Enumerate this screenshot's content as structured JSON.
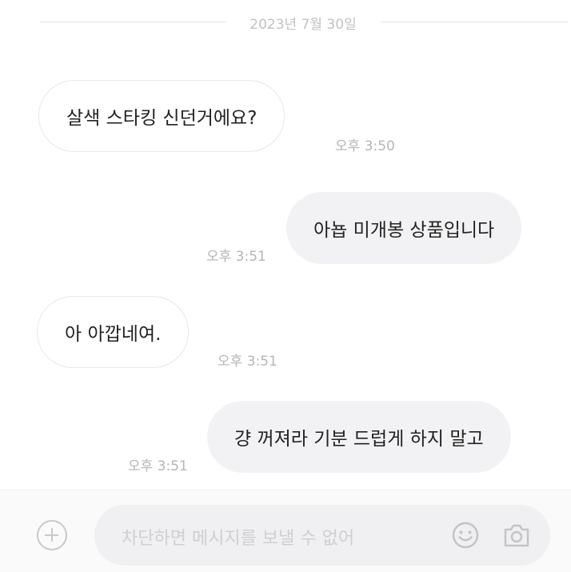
{
  "chat": {
    "date": "2023년 7월 30일",
    "messages": [
      {
        "side": "received",
        "text": "살색 스타킹 신던거에요?",
        "time": "오후 3:50"
      },
      {
        "side": "sent",
        "text": "아뇹 미개봉 상품입니다",
        "time": "오후 3:51"
      },
      {
        "side": "received",
        "text": "아 아깝네여.",
        "time": "오후 3:51"
      },
      {
        "side": "sent",
        "text": "걍 꺼져라 기분 드럽게 하지 말고",
        "time": "오후 3:51"
      }
    ]
  },
  "composer": {
    "placeholder": "차단하면 메시지를 보낼 수 없어",
    "icons": {
      "add": "plus-circle-icon",
      "emoji": "smiley-icon",
      "camera": "camera-icon"
    }
  },
  "colors": {
    "sent_bubble": "#f2f2f4",
    "received_bubble": "#ffffff",
    "timestamp": "#b5b5b5",
    "composer_bg": "#f0f0f2"
  }
}
